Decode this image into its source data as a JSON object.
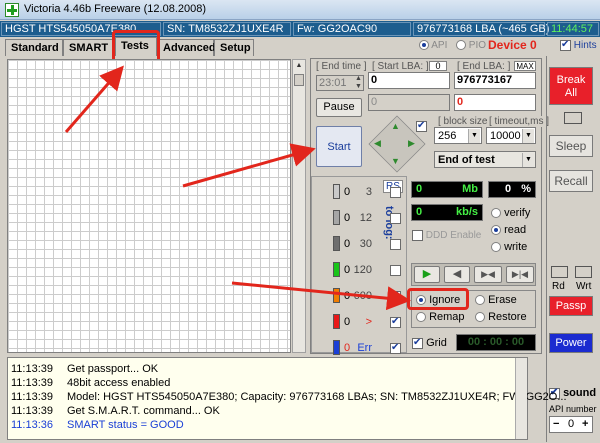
{
  "window": {
    "title": "Victoria 4.46b Freeware (12.08.2008)"
  },
  "infobar": {
    "model": "HGST HTS545050A7E380",
    "serial": "SN: TM8532ZJ1UXE4R",
    "firmware": "Fw: GG2OAC90",
    "capacity": "976773168 LBA (~465 GB)",
    "clock": "11:44:57"
  },
  "tabs": [
    "Standard",
    "SMART",
    "Tests",
    "Advanced",
    "Setup"
  ],
  "active_tab": "Tests",
  "mode": {
    "api": "API",
    "pio": "PIO",
    "device": "Device 0",
    "hints": "Hints"
  },
  "tests": {
    "end_time_label": "[ End time ]",
    "end_time": "23:01",
    "start_lba_label": "[ Start LBA: ]",
    "start_lba_mark": "0",
    "start_lba": "0",
    "start_lba_cur": "0",
    "end_lba_label": "[ End LBA: ]",
    "end_lba_mark": "MAX",
    "end_lba": "976773167",
    "end_lba_cur": "0",
    "pause": "Pause",
    "start": "Start",
    "block_size_label": "[ block size ]",
    "block_size": "256",
    "timeout_label": "[ timeout,ms ]",
    "timeout": "10000",
    "end_action": "End of test"
  },
  "blocks": [
    {
      "label": "3",
      "count": "0",
      "color": "#c9c9c9"
    },
    {
      "label": "12",
      "count": "0",
      "color": "#a6a6a6"
    },
    {
      "label": "30",
      "count": "0",
      "color": "#6e6e6e"
    },
    {
      "label": "120",
      "count": "0",
      "color": "#19c419"
    },
    {
      "label": "600",
      "count": "0",
      "color": "#f07d00"
    },
    {
      "label": ">",
      "count": "0",
      "color": "#e81818"
    },
    {
      "label": "Err",
      "count": "0",
      "color": "#1a3fd6"
    }
  ],
  "rs": "RS",
  "to_log": "to log:",
  "readout": {
    "mb": "0",
    "mb_unit": "Mb",
    "pct": "0",
    "pct_unit": "%",
    "kbs": "0",
    "kbs_unit": "kb/s"
  },
  "mode_radios": {
    "verify": "verify",
    "read": "read",
    "write": "write",
    "ddd": "DDD Enable"
  },
  "actions": {
    "ignore": "Ignore",
    "erase": "Erase",
    "remap": "Remap",
    "restore": "Restore"
  },
  "grid_label": "Grid",
  "timer": "00 : 00 : 00",
  "side": {
    "break_all": "Break All",
    "sleep": "Sleep",
    "recall": "Recall",
    "rd": "Rd",
    "wrt": "Wrt",
    "passp": "Passp",
    "power": "Power",
    "sound": "sound",
    "api_number_label": "API number",
    "api_number": "0"
  },
  "log": [
    {
      "time": "11:13:39",
      "msg": "Get passport... OK",
      "color": "#000"
    },
    {
      "time": "11:13:39",
      "msg": "48bit access enabled",
      "color": "#000"
    },
    {
      "time": "11:13:39",
      "msg": "Model: HGST HTS545050A7E380; Capacity: 976773168 LBAs; SN: TM8532ZJ1UXE4R; FW: GG2O...",
      "color": "#000"
    },
    {
      "time": "11:13:39",
      "msg": "Get S.M.A.R.T. command... OK",
      "color": "#000"
    },
    {
      "time": "11:13:36",
      "msg": "SMART status = GOOD",
      "color": "#1a3fd6"
    }
  ],
  "colors": {
    "accent_red": "#e2261c",
    "infobar": "#1d5d8e",
    "break_all": "#e8202a",
    "power": "#1b2bd0"
  }
}
